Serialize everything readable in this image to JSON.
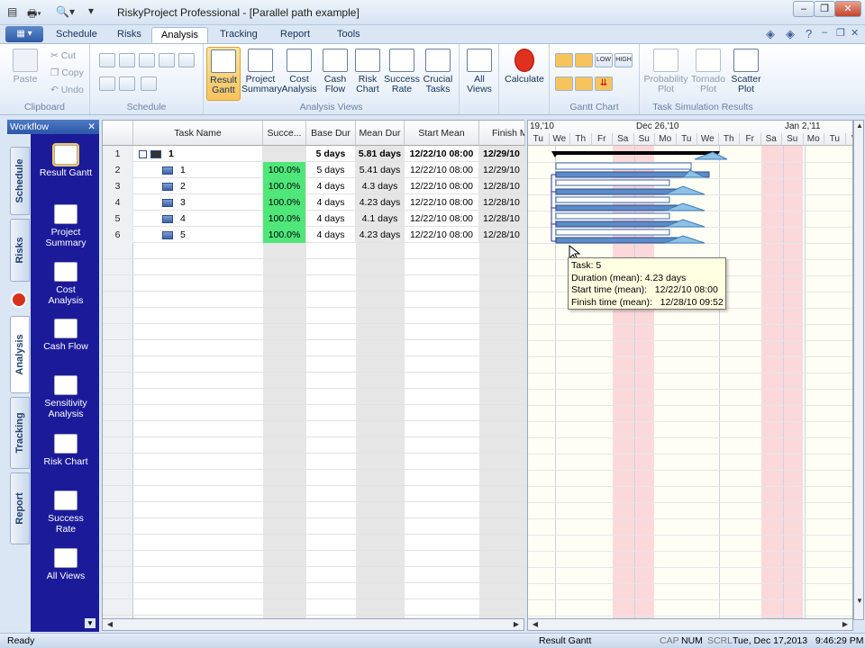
{
  "window": {
    "title": "RiskyProject Professional - [Parallel path example]",
    "controls": {
      "minimize": "–",
      "restore": "❐",
      "close": "✕"
    }
  },
  "ribbon_tabs": [
    "Schedule",
    "Risks",
    "Analysis",
    "Tracking",
    "Report",
    "Tools"
  ],
  "active_tab": "Analysis",
  "ribbon": {
    "clipboard": {
      "group": "Clipboard",
      "paste": "Paste",
      "cut": "Cut",
      "copy": "Copy",
      "undo": "Undo"
    },
    "schedule_group": "Schedule",
    "analysis_views": {
      "group": "Analysis Views",
      "buttons": [
        {
          "l1": "Result",
          "l2": "Gantt"
        },
        {
          "l1": "Project",
          "l2": "Summary"
        },
        {
          "l1": "Cost",
          "l2": "Analysis"
        },
        {
          "l1": "Cash",
          "l2": "Flow"
        },
        {
          "l1": "Risk",
          "l2": "Chart"
        },
        {
          "l1": "Success",
          "l2": "Rate"
        },
        {
          "l1": "Crucial",
          "l2": "Tasks"
        }
      ],
      "all_views": {
        "l1": "All",
        "l2": "Views"
      }
    },
    "calculate": "Calculate",
    "gantt_chart_group": "Gantt Chart",
    "gantt_small": {
      "low": "LOW",
      "high": "HIGH"
    },
    "task_sim": {
      "group": "Task Simulation Results",
      "buttons": [
        {
          "l1": "Probability",
          "l2": "Plot"
        },
        {
          "l1": "Tornado",
          "l2": "Plot"
        },
        {
          "l1": "Scatter",
          "l2": "Plot"
        }
      ]
    }
  },
  "workflow": {
    "title": "Workflow",
    "close": "✕",
    "vtabs": [
      "Schedule",
      "Risks",
      "Analysis",
      "Tracking",
      "Report"
    ],
    "items": [
      {
        "l1": "Result Gantt",
        "l2": ""
      },
      {
        "l1": "Project",
        "l2": "Summary"
      },
      {
        "l1": "Cost",
        "l2": "Analysis"
      },
      {
        "l1": "Cash Flow",
        "l2": ""
      },
      {
        "l1": "Sensitivity",
        "l2": "Analysis"
      },
      {
        "l1": "Risk Chart",
        "l2": ""
      },
      {
        "l1": "Success",
        "l2": "Rate"
      },
      {
        "l1": "All Views",
        "l2": ""
      }
    ]
  },
  "grid": {
    "columns": [
      "Task Name",
      "Succe...",
      "Base Dur",
      "Mean Dur",
      "Start Mean",
      "Finish M"
    ],
    "rows": [
      {
        "num": "1",
        "name": "1",
        "succ": "",
        "base": "5 days",
        "mean": "5.81 days",
        "start": "12/22/10 08:00",
        "finish": "12/29/10",
        "summary": true
      },
      {
        "num": "2",
        "name": "1",
        "succ": "100.0%",
        "base": "5 days",
        "mean": "5.41 days",
        "start": "12/22/10 08:00",
        "finish": "12/29/10",
        "summary": false
      },
      {
        "num": "3",
        "name": "2",
        "succ": "100.0%",
        "base": "4 days",
        "mean": "4.3 days",
        "start": "12/22/10 08:00",
        "finish": "12/28/10",
        "summary": false
      },
      {
        "num": "4",
        "name": "3",
        "succ": "100.0%",
        "base": "4 days",
        "mean": "4.23 days",
        "start": "12/22/10 08:00",
        "finish": "12/28/10",
        "summary": false
      },
      {
        "num": "5",
        "name": "4",
        "succ": "100.0%",
        "base": "4 days",
        "mean": "4.1 days",
        "start": "12/22/10 08:00",
        "finish": "12/28/10",
        "summary": false
      },
      {
        "num": "6",
        "name": "5",
        "succ": "100.0%",
        "base": "4 days",
        "mean": "4.23 days",
        "start": "12/22/10 08:00",
        "finish": "12/28/10",
        "summary": false
      }
    ]
  },
  "gantt": {
    "weeks": [
      "19,'10",
      "Dec 26,'10",
      "Jan 2,'11"
    ],
    "days": [
      "Tu",
      "We",
      "Th",
      "Fr",
      "Sa",
      "Su",
      "Mo",
      "Tu",
      "We",
      "Th",
      "Fr",
      "Sa",
      "Su",
      "Mo",
      "Tu",
      "W"
    ]
  },
  "tooltip": {
    "task": "Task: 5",
    "duration": "Duration (mean): 4.23 days",
    "start": "Start time (mean):   12/22/10 08:00",
    "finish": "Finish time (mean):   12/28/10 09:52"
  },
  "status": {
    "left": "Ready",
    "view": "Result Gantt",
    "cap": "CAP",
    "num": "NUM",
    "scrl": "SCRL",
    "datetime": "Tue, Dec 17,2013   9:46:29 PM"
  }
}
